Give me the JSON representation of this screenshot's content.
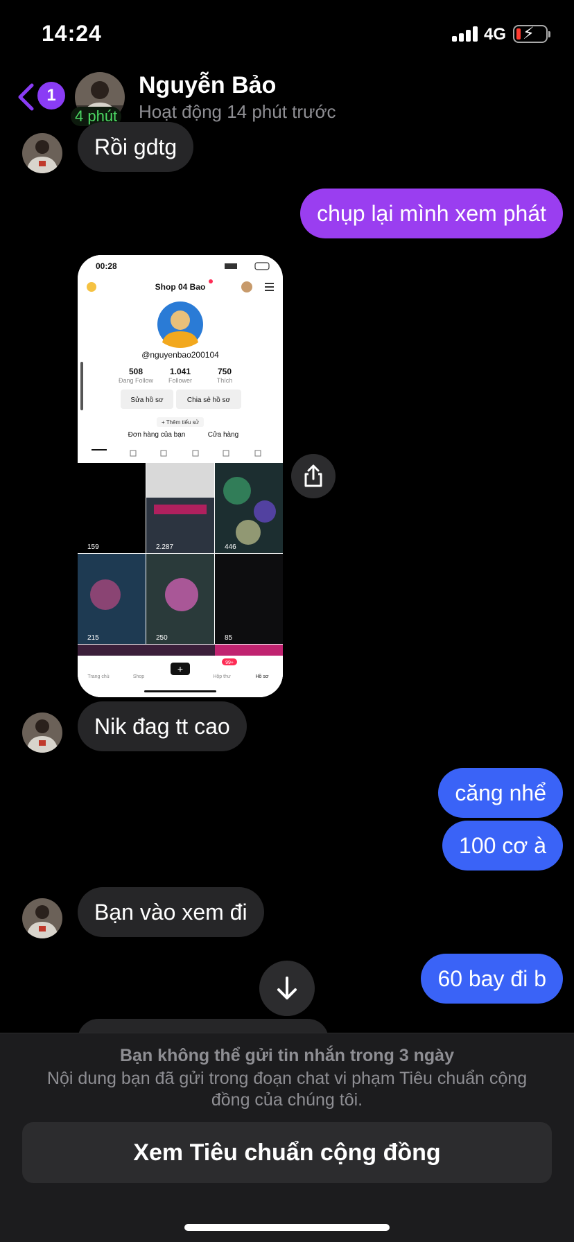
{
  "status_bar": {
    "time": "14:24",
    "network": "4G"
  },
  "header": {
    "unread_count": "1",
    "contact_name": "Nguyễn Bảo",
    "active_badge": "4 phút",
    "status": "Hoạt động 14 phút trước"
  },
  "colors": {
    "accent_purple": "#8a3cf5",
    "bubble_purple": "#9a3ef0",
    "bubble_blue": "#3a63f7",
    "incoming_bubble": "#262628",
    "background": "#000000"
  },
  "messages": [
    {
      "direction": "in",
      "text": "Rồi gdtg"
    },
    {
      "direction": "out",
      "text": "chụp lại mình xem phát"
    },
    {
      "direction": "in",
      "type": "image"
    },
    {
      "direction": "in",
      "text": "Nik đag tt cao"
    },
    {
      "direction": "out",
      "text": "căng nhể"
    },
    {
      "direction": "out",
      "text": "100 cơ à"
    },
    {
      "direction": "in",
      "text": "Bạn vào xem đi"
    },
    {
      "direction": "out",
      "text": "60 bay đi b"
    }
  ],
  "shared_screenshot": {
    "time": "00:28",
    "shop_title": "Shop 04 Bao",
    "username": "@nguyenbao200104",
    "stats": [
      {
        "value": "508",
        "label": "Đang Follow"
      },
      {
        "value": "1.041",
        "label": "Follower"
      },
      {
        "value": "750",
        "label": "Thích"
      }
    ],
    "edit_profile": "Sửa hồ sơ",
    "share_profile": "Chia sẻ hồ sơ",
    "add_bio": "+ Thêm tiểu sử",
    "orders": "Đơn hàng của bạn",
    "store": "Cửa hàng",
    "video_views": [
      "159",
      "2.287",
      "446",
      "215",
      "250",
      "85"
    ],
    "nav": [
      "Trang chủ",
      "Shop",
      "Hộp thư",
      "Hồ sơ"
    ],
    "inbox_badge": "99+"
  },
  "notice": {
    "title": "Bạn không thể gửi tin nhắn trong 3 ngày",
    "body": "Nội dung bạn đã gửi trong đoạn chat vi phạm Tiêu chuẩn cộng đồng của chúng tôi.",
    "button": "Xem Tiêu chuẩn cộng đồng"
  }
}
